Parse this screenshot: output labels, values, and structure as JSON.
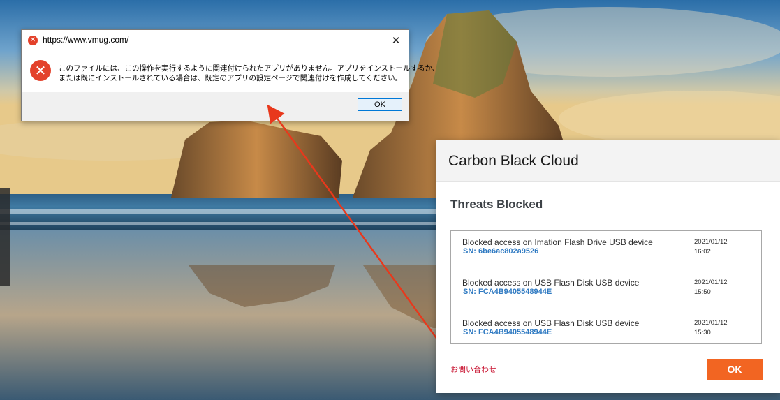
{
  "win_dialog": {
    "title": "https://www.vmug.com/",
    "message_line1": "このファイルには、この操作を実行するように関連付けられたアプリがありません。アプリをインストールするか、",
    "message_line2": "または既にインストールされている場合は、既定のアプリの設定ページで関連付けを作成してください。",
    "ok_label": "OK",
    "close_glyph": "✕",
    "error_icon": "error-x-icon",
    "error_color": "#e3412b"
  },
  "carbon_black": {
    "title": "Carbon Black Cloud",
    "subtitle": "Threats Blocked",
    "items": [
      {
        "description": "Blocked access on Imation Flash Drive USB device",
        "serial": "SN: 6be6ac802a9526",
        "date": "2021/01/12",
        "time": "16:02"
      },
      {
        "description": "Blocked access on USB Flash Disk USB device",
        "serial": "SN: FCA4B9405548944E",
        "date": "2021/01/12",
        "time": "15:50"
      },
      {
        "description": "Blocked access on USB Flash Disk USB device",
        "serial": "SN: FCA4B9405548944E",
        "date": "2021/01/12",
        "time": "15:30"
      }
    ],
    "contact_label": "お問い合わせ",
    "ok_label": "OK",
    "accent_color": "#f26522",
    "serial_color": "#2f7ac2"
  },
  "annotation": {
    "color": "#e8381c"
  }
}
